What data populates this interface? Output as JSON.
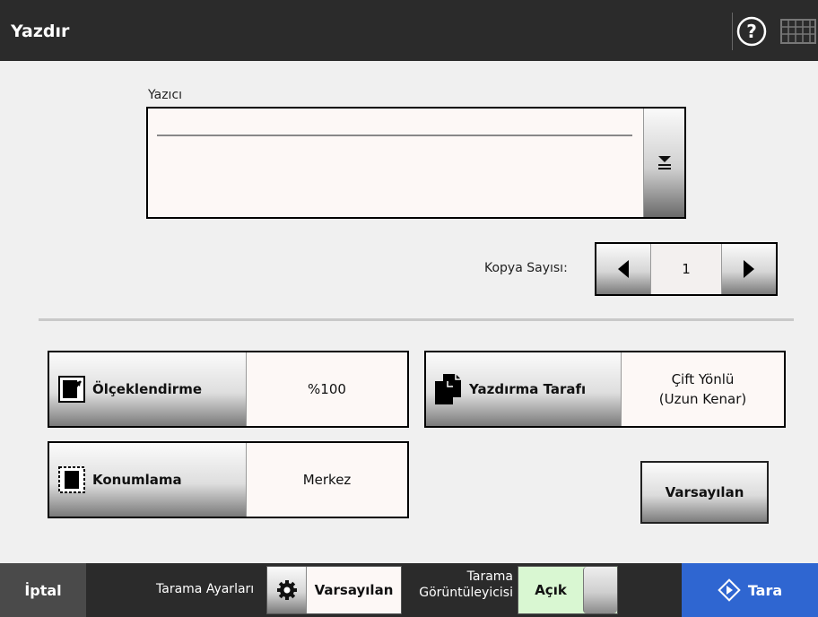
{
  "header": {
    "title": "Yazdır",
    "help_icon": "help-icon",
    "keyboard_icon": "keyboard-icon"
  },
  "printer": {
    "label": "Yazıcı",
    "value": "",
    "dropdown_icon": "list-dropdown-icon"
  },
  "copies": {
    "label": "Kopya Sayısı:",
    "value": "1"
  },
  "settings": {
    "scaling": {
      "label": "Ölçeklendirme",
      "value": "%100"
    },
    "print_side": {
      "label": "Yazdırma Tarafı",
      "value_line1": "Çift Yönlü",
      "value_line2": "(Uzun Kenar)"
    },
    "positioning": {
      "label": "Konumlama",
      "value": "Merkez"
    }
  },
  "default_button": "Varsayılan",
  "footer": {
    "cancel": "İptal",
    "scan_settings_label": "Tarama Ayarları",
    "scan_settings_value": "Varsayılan",
    "viewer_label_line1": "Tarama",
    "viewer_label_line2": "Görüntüleyicisi",
    "viewer_value": "Açık",
    "scan_button": "Tara"
  },
  "colors": {
    "header_bg": "#2b2b2b",
    "scan_button": "#2f66d1",
    "toggle_on": "#d9f7d2"
  }
}
